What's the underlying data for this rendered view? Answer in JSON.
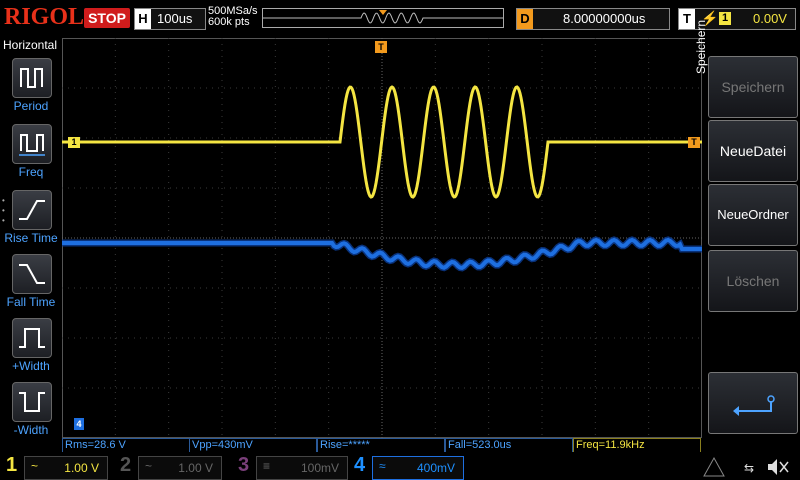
{
  "header": {
    "logo": "RIGOL",
    "run_state": "STOP",
    "horizontal_key": "H",
    "timebase": "100us",
    "sample_rate": "500MSa/s",
    "mem_depth": "600k pts",
    "delay_key": "D",
    "delay": "8.00000000us",
    "trigger_key": "T",
    "trigger_source": "1",
    "trigger_level": "0.00V"
  },
  "left_panel": {
    "title": "Horizontal",
    "items": [
      {
        "label": "Period"
      },
      {
        "label": "Freq"
      },
      {
        "label": "Rise Time"
      },
      {
        "label": "Fall Time"
      },
      {
        "label": "+Width"
      },
      {
        "label": "-Width"
      }
    ]
  },
  "right_menu": {
    "title": "Speichern",
    "items": [
      {
        "label": "Speichern",
        "enabled": false
      },
      {
        "label": "NeueDatei",
        "enabled": true
      },
      {
        "label": "NeueOrdner",
        "enabled": true
      },
      {
        "label": "Löschen",
        "enabled": false
      }
    ]
  },
  "measurements": [
    {
      "text": "Rms=28.6 V",
      "color": "#4da3ff"
    },
    {
      "text": "Vpp=430mV",
      "color": "#4da3ff"
    },
    {
      "text": "Rise=*****",
      "color": "#4da3ff"
    },
    {
      "text": "Fall=523.0us",
      "color": "#4da3ff"
    },
    {
      "text": "Freq=11.9kHz",
      "color": "#f4e542"
    }
  ],
  "channels": [
    {
      "num": "1",
      "coupling": "~",
      "scale": "1.00 V",
      "color": "#f4e542",
      "active": true
    },
    {
      "num": "2",
      "coupling": "~",
      "scale": "1.00 V",
      "color": "#555555",
      "active": false
    },
    {
      "num": "3",
      "coupling": "≡",
      "scale": "100mV",
      "color": "#7a3f7a",
      "active": false
    },
    {
      "num": "4",
      "coupling": "≈",
      "scale": "400mV",
      "color": "#1e90ff",
      "active": true
    }
  ],
  "markers": {
    "ch1_marker": "1",
    "trigger_marker": "T",
    "ch4_marker": "4"
  },
  "colors": {
    "ch1": "#f4e542",
    "ch4": "#1e6fe0",
    "trigger": "#f39a1d",
    "accent_blue": "#4da3ff"
  }
}
